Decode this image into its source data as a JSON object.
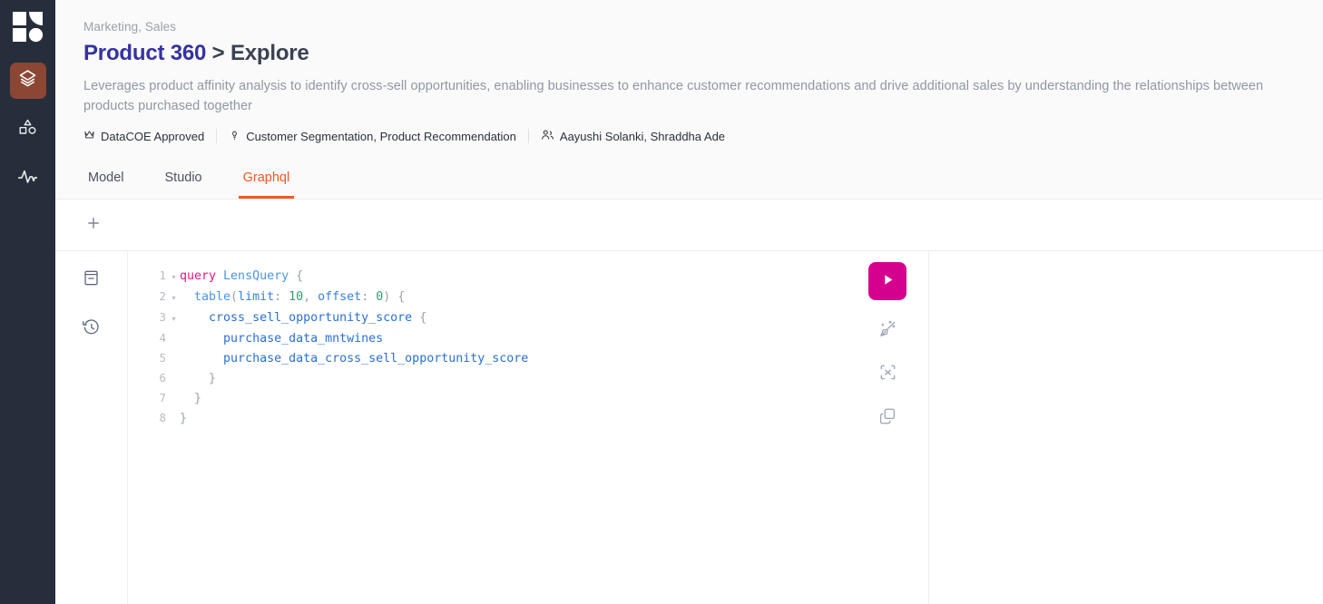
{
  "colors": {
    "rail_bg": "#262E3B",
    "rail_active": "#8C4634",
    "title_accent": "#3532A0",
    "tab_active": "#F25822",
    "run_button": "#D6008F",
    "code_keyword": "#E5177F",
    "code_field": "#2A6FD6",
    "code_number": "#2EA06B"
  },
  "rail": {
    "logo_name": "lens-logo",
    "items": [
      {
        "name": "sidebar-item-lens",
        "icon": "layers-icon",
        "active": true
      },
      {
        "name": "sidebar-item-shapes",
        "icon": "shapes-icon",
        "active": false
      },
      {
        "name": "sidebar-item-activity",
        "icon": "activity-pulse-icon",
        "active": false
      }
    ]
  },
  "header": {
    "categories": "Marketing, Sales",
    "title_main": "Product 360",
    "title_separator": " > ",
    "title_sub": "Explore",
    "description": "Leverages product affinity analysis to identify cross-sell opportunities, enabling businesses to enhance customer recommendations and drive additional sales by understanding the relationships between products purchased together",
    "meta": [
      {
        "name": "approval-badge",
        "icon": "crown-icon",
        "label": "DataCOE Approved"
      },
      {
        "name": "usecase-tags",
        "icon": "lightbulb-icon",
        "label": "Customer Segmentation, Product Recommendation"
      },
      {
        "name": "owners",
        "icon": "users-icon",
        "label": "Aayushi Solanki, Shraddha Ade"
      }
    ]
  },
  "tabs": [
    {
      "name": "tab-model",
      "label": "Model",
      "active": false
    },
    {
      "name": "tab-studio",
      "label": "Studio",
      "active": false
    },
    {
      "name": "tab-graphql",
      "label": "Graphql",
      "active": true
    }
  ],
  "query_tabbar": {
    "add_label": "+",
    "add_icon": "plus-icon"
  },
  "tools": [
    {
      "name": "docs-button",
      "icon": "book-docs-icon"
    },
    {
      "name": "history-button",
      "icon": "clock-history-icon"
    }
  ],
  "editor": {
    "lines": [
      {
        "number": "1",
        "fold": "▾",
        "tokens": [
          {
            "cls": "tk-kw",
            "t": "query "
          },
          {
            "cls": "tk-name",
            "t": "LensQuery"
          },
          {
            "cls": "tk-op",
            "t": " {"
          }
        ]
      },
      {
        "number": "2",
        "fold": "▾",
        "tokens": [
          {
            "cls": "tk-op",
            "t": "  "
          },
          {
            "cls": "tk-fn",
            "t": "table"
          },
          {
            "cls": "tk-op",
            "t": "("
          },
          {
            "cls": "tk-arg",
            "t": "limit"
          },
          {
            "cls": "tk-op",
            "t": ": "
          },
          {
            "cls": "tk-num",
            "t": "10"
          },
          {
            "cls": "tk-op",
            "t": ", "
          },
          {
            "cls": "tk-arg",
            "t": "offset"
          },
          {
            "cls": "tk-op",
            "t": ": "
          },
          {
            "cls": "tk-num",
            "t": "0"
          },
          {
            "cls": "tk-op",
            "t": ") {"
          }
        ]
      },
      {
        "number": "3",
        "fold": "▾",
        "tokens": [
          {
            "cls": "tk-op",
            "t": "    "
          },
          {
            "cls": "tk-fld",
            "t": "cross_sell_opportunity_score"
          },
          {
            "cls": "tk-op",
            "t": " {"
          }
        ]
      },
      {
        "number": "4",
        "fold": "",
        "tokens": [
          {
            "cls": "tk-op",
            "t": "      "
          },
          {
            "cls": "tk-fld",
            "t": "purchase_data_mntwines"
          }
        ]
      },
      {
        "number": "5",
        "fold": "",
        "tokens": [
          {
            "cls": "tk-op",
            "t": "      "
          },
          {
            "cls": "tk-fld",
            "t": "purchase_data_cross_sell_opportunity_score"
          }
        ]
      },
      {
        "number": "6",
        "fold": "",
        "tokens": [
          {
            "cls": "tk-op",
            "t": "    }"
          }
        ]
      },
      {
        "number": "7",
        "fold": "",
        "tokens": [
          {
            "cls": "tk-op",
            "t": "  }"
          }
        ]
      },
      {
        "number": "8",
        "fold": "",
        "tokens": [
          {
            "cls": "tk-op",
            "t": "}"
          }
        ]
      }
    ]
  },
  "actions": [
    {
      "name": "run-query-button",
      "icon": "play-icon",
      "primary": true
    },
    {
      "name": "prettify-button",
      "icon": "magic-broom-icon",
      "primary": false
    },
    {
      "name": "merge-fragments-button",
      "icon": "collapse-brackets-icon",
      "primary": false
    },
    {
      "name": "copy-query-button",
      "icon": "copy-icon",
      "primary": false
    }
  ],
  "result_panel": {
    "name": "query-result-panel",
    "content": ""
  }
}
